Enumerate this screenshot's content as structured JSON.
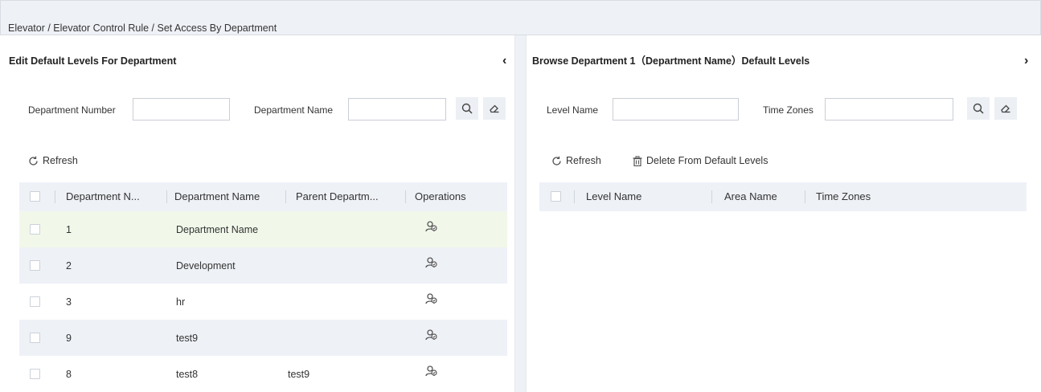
{
  "breadcrumb": "Elevator / Elevator Control Rule / Set Access By Department",
  "left_panel": {
    "title": "Edit Default Levels For Department",
    "collapse_glyph": "‹",
    "filters": {
      "department_number_label": "Department Number",
      "department_number_value": "",
      "department_name_label": "Department Name",
      "department_name_value": ""
    },
    "search_icon": "search-icon",
    "clear_icon": "eraser-icon",
    "refresh_label": "Refresh",
    "columns": [
      "Department N...",
      "Department Name",
      "Parent Departm...",
      "Operations"
    ],
    "rows": [
      {
        "number": "1",
        "name": "Department Name",
        "parent": "",
        "highlight": "selected"
      },
      {
        "number": "2",
        "name": "Development",
        "parent": "",
        "highlight": "striped"
      },
      {
        "number": "3",
        "name": "hr",
        "parent": "",
        "highlight": "none"
      },
      {
        "number": "9",
        "name": "test9",
        "parent": "",
        "highlight": "striped"
      },
      {
        "number": "8",
        "name": "test8",
        "parent": "test9",
        "highlight": "none"
      }
    ],
    "operation_icon": "user-group-icon"
  },
  "right_panel": {
    "title": "Browse Department 1（Department Name）Default Levels",
    "collapse_glyph": "›",
    "filters": {
      "level_name_label": "Level Name",
      "level_name_value": "",
      "time_zones_label": "Time Zones",
      "time_zones_value": ""
    },
    "refresh_label": "Refresh",
    "delete_label": "Delete From Default Levels",
    "columns": [
      "Level Name",
      "Area Name",
      "Time Zones"
    ]
  },
  "colors": {
    "header_bg": "#eef1f6",
    "selected_row_bg": "#f1f8ea",
    "striped_row_bg": "#eef1f6",
    "border": "#c9ced6"
  }
}
